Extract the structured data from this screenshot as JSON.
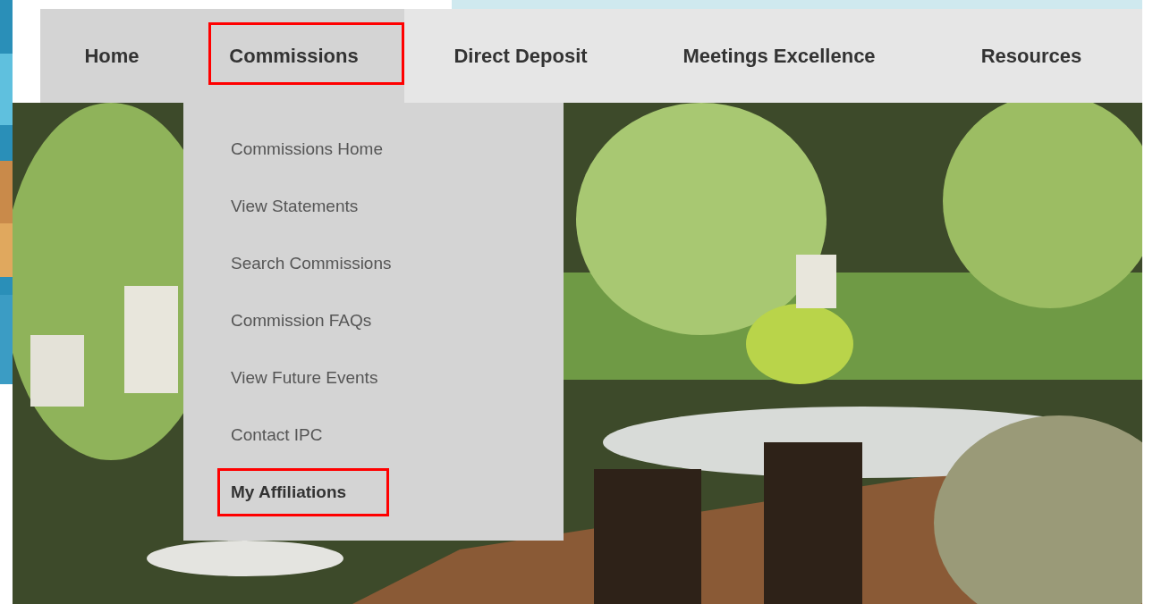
{
  "nav": {
    "tabs": [
      {
        "label": "Home",
        "selected": true,
        "outlined": false
      },
      {
        "label": "Commissions",
        "selected": true,
        "outlined": true
      },
      {
        "label": "Direct Deposit",
        "selected": false,
        "outlined": false
      },
      {
        "label": "Meetings Excellence",
        "selected": false,
        "outlined": false
      },
      {
        "label": "Resources",
        "selected": false,
        "outlined": false
      }
    ]
  },
  "dropdown": {
    "items": [
      {
        "label": "Commissions Home",
        "bold": false,
        "outlined": false
      },
      {
        "label": "View Statements",
        "bold": false,
        "outlined": false
      },
      {
        "label": "Search Commissions",
        "bold": false,
        "outlined": false
      },
      {
        "label": "Commission FAQs",
        "bold": false,
        "outlined": false
      },
      {
        "label": "View Future Events",
        "bold": false,
        "outlined": false
      },
      {
        "label": "Contact IPC",
        "bold": false,
        "outlined": false
      },
      {
        "label": "My Affiliations",
        "bold": true,
        "outlined": true
      }
    ]
  }
}
